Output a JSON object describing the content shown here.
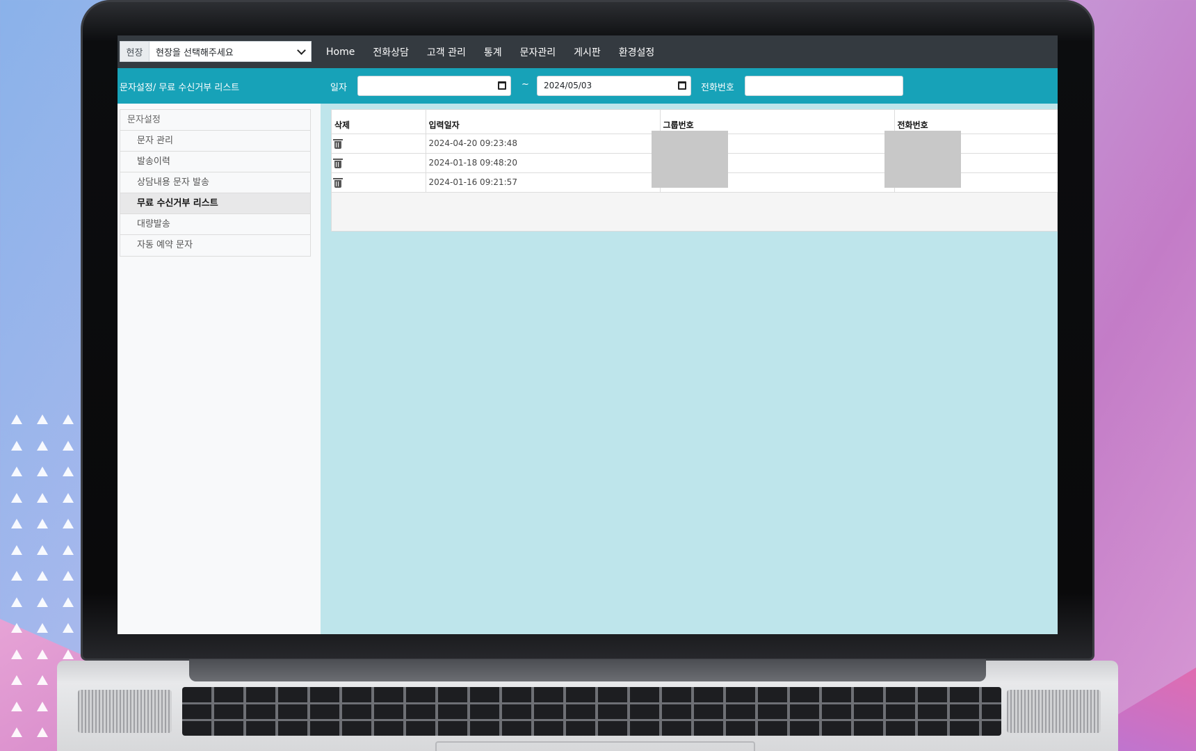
{
  "site": {
    "prefix": "현장",
    "placeholder": "현장을 선택해주세요"
  },
  "nav": {
    "items": [
      "Home",
      "전화상담",
      "고객 관리",
      "통계",
      "문자관리",
      "게시판",
      "환경설정"
    ]
  },
  "filter": {
    "breadcrumb": "문자설정/ 무료 수신거부 리스트",
    "date_label": "일자",
    "date_from": "",
    "separator": "~",
    "date_to": "2024/05/03",
    "phone_label": "전화번호",
    "phone_value": ""
  },
  "sidebar": {
    "header": "문자설정",
    "items": [
      {
        "label": "문자 관리",
        "active": false
      },
      {
        "label": "발송이력",
        "active": false
      },
      {
        "label": "상담내용 문자 발송",
        "active": false
      },
      {
        "label": "무료 수신거부 리스트",
        "active": true
      },
      {
        "label": "대량발송",
        "active": false
      },
      {
        "label": "자동 예약 문자",
        "active": false
      }
    ]
  },
  "table": {
    "columns": [
      "삭제",
      "입력일자",
      "그룹번호",
      "전화번호"
    ],
    "rows": [
      {
        "date": "2024-04-20 09:23:48",
        "group": "",
        "phone": ""
      },
      {
        "date": "2024-01-18 09:48:20",
        "group": "",
        "phone": ""
      },
      {
        "date": "2024-01-16 09:21:57",
        "group": "",
        "phone": ""
      }
    ]
  },
  "icons": {
    "delete": "trash-icon",
    "date": "calendar-icon",
    "select": "chevron-down-icon"
  },
  "colors": {
    "topbar": "#343a40",
    "filterbar": "#17a2b8",
    "content_bg": "#bee5eb"
  }
}
